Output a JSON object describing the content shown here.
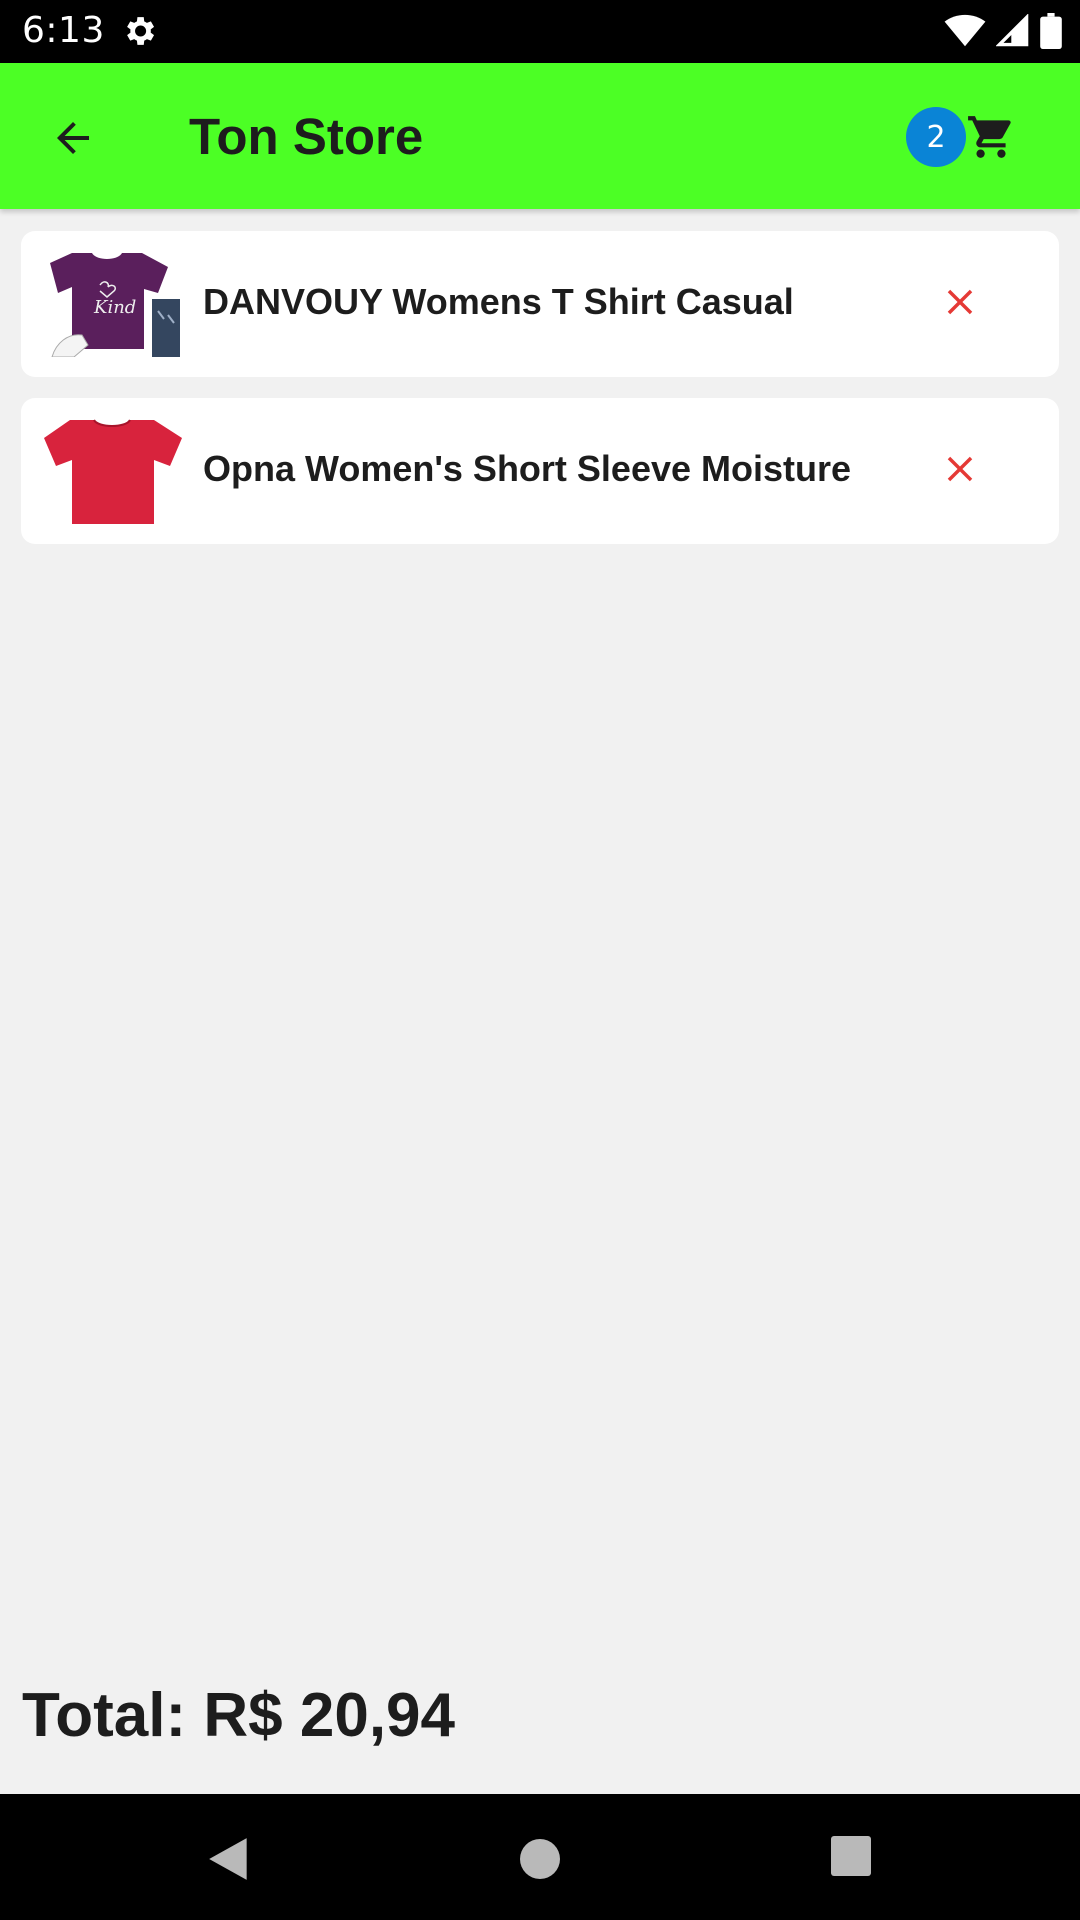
{
  "status_bar": {
    "time": "6:13",
    "icons": [
      "gear-icon",
      "wifi-icon",
      "cell-signal-icon",
      "battery-icon"
    ]
  },
  "app_bar": {
    "title": "Ton Store",
    "cart_count": "2",
    "background_color": "#4cff25",
    "badge_color": "#0a84d6"
  },
  "cart": {
    "items": [
      {
        "title": "DANVOUY Womens T Shirt Casual",
        "image": "purple-tshirt"
      },
      {
        "title": "Opna Women's Short Sleeve Moisture",
        "image": "red-tshirt"
      }
    ],
    "remove_color": "#e53935"
  },
  "total": "Total: R$ 20,94"
}
